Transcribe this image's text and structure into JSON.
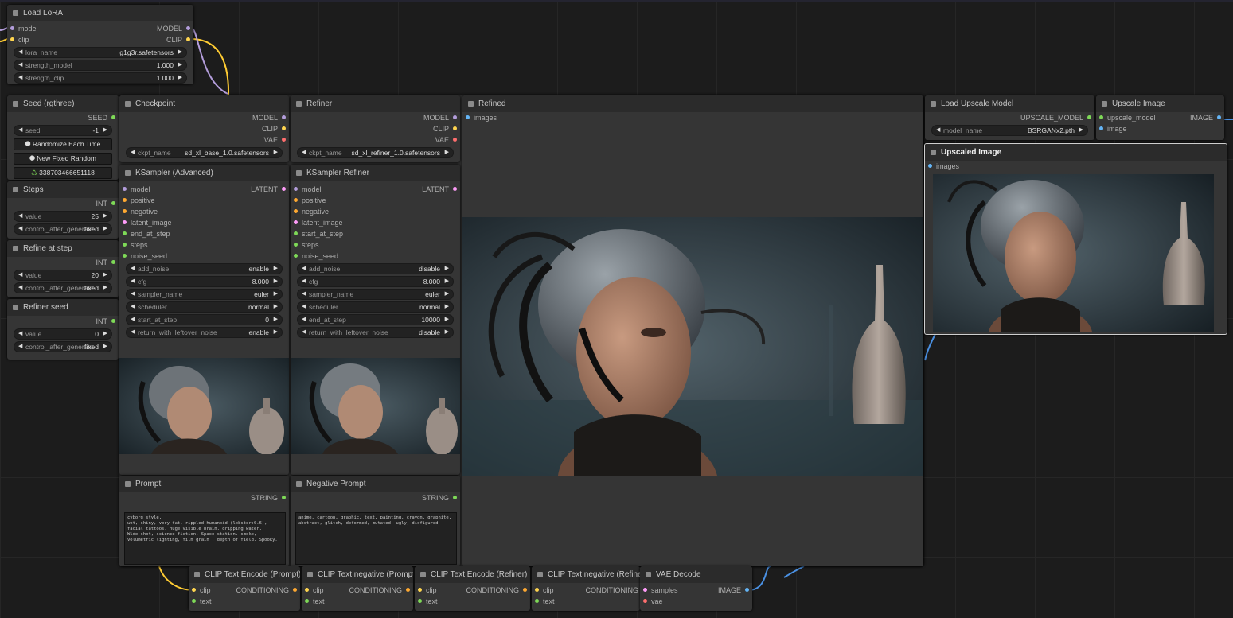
{
  "colors": {
    "model": "#b39ddb",
    "clip": "#ffd54f",
    "vae": "#ff6e6e",
    "latent": "#ff9cf9",
    "conditioning": "#ffa931",
    "int": "#7ed957",
    "string": "#7ed957",
    "image": "#64b5f6",
    "upscale_model": "#7ed957",
    "link_yellow": "#ffcc33",
    "link_purple": "#b39ddb",
    "link_blue": "#4a90e2"
  },
  "load_lora": {
    "title": "Load LoRA",
    "in_model": "model",
    "in_clip": "clip",
    "out_model": "MODEL",
    "out_clip": "CLIP",
    "widgets": [
      {
        "name": "lora_name",
        "value": "g1g3r.safetensors"
      },
      {
        "name": "strength_model",
        "value": "1.000"
      },
      {
        "name": "strength_clip",
        "value": "1.000"
      }
    ]
  },
  "seed": {
    "title": "Seed (rgthree)",
    "out": "SEED",
    "widget_name": "seed",
    "widget_value": "-1",
    "btn_randomize": "Randomize Each Time",
    "btn_new_fixed": "New Fixed Random",
    "btn_last": "338703466651118"
  },
  "steps": {
    "title": "Steps",
    "out": "INT",
    "value_name": "value",
    "value": "25",
    "control_name": "control_after_generate",
    "control_value": "fixed"
  },
  "refine_at_step": {
    "title": "Refine at step",
    "out": "INT",
    "value_name": "value",
    "value": "20",
    "control_name": "control_after_generate",
    "control_value": "fixed"
  },
  "refiner_seed": {
    "title": "Refiner seed",
    "out": "INT",
    "value_name": "value",
    "value": "0",
    "control_name": "control_after_generate",
    "control_value": "fixed"
  },
  "checkpoint": {
    "title": "Checkpoint",
    "out_model": "MODEL",
    "out_clip": "CLIP",
    "out_vae": "VAE",
    "ckpt_label": "ckpt_name",
    "ckpt_value": "sd_xl_base_1.0.safetensors"
  },
  "refiner": {
    "title": "Refiner",
    "out_model": "MODEL",
    "out_clip": "CLIP",
    "out_vae": "VAE",
    "ckpt_label": "ckpt_name",
    "ckpt_value": "sd_xl_refiner_1.0.safetensors"
  },
  "ksampler_adv": {
    "title": "KSampler (Advanced)",
    "out": "LATENT",
    "inputs": [
      "model",
      "positive",
      "negative",
      "latent_image",
      "end_at_step",
      "steps",
      "noise_seed"
    ],
    "widgets": [
      {
        "name": "add_noise",
        "value": "enable"
      },
      {
        "name": "cfg",
        "value": "8.000"
      },
      {
        "name": "sampler_name",
        "value": "euler"
      },
      {
        "name": "scheduler",
        "value": "normal"
      },
      {
        "name": "start_at_step",
        "value": "0"
      },
      {
        "name": "return_with_leftover_noise",
        "value": "enable"
      }
    ]
  },
  "ksampler_ref": {
    "title": "KSampler Refiner",
    "out": "LATENT",
    "inputs": [
      "model",
      "positive",
      "negative",
      "latent_image",
      "start_at_step",
      "steps",
      "noise_seed"
    ],
    "widgets": [
      {
        "name": "add_noise",
        "value": "disable"
      },
      {
        "name": "cfg",
        "value": "8.000"
      },
      {
        "name": "sampler_name",
        "value": "euler"
      },
      {
        "name": "scheduler",
        "value": "normal"
      },
      {
        "name": "end_at_step",
        "value": "10000"
      },
      {
        "name": "return_with_leftover_noise",
        "value": "disable"
      }
    ]
  },
  "refined": {
    "title": "Refined",
    "in_images": "images"
  },
  "load_upscale": {
    "title": "Load Upscale Model",
    "out": "UPSCALE_MODEL",
    "widget_name": "model_name",
    "widget_value": "BSRGANx2.pth"
  },
  "upscale_image": {
    "title": "Upscale Image",
    "in_model": "upscale_model",
    "in_image": "image",
    "out": "IMAGE"
  },
  "upscaled": {
    "title": "Upscaled Image",
    "in_images": "images"
  },
  "prompt": {
    "title": "Prompt",
    "out": "STRING",
    "text": "cyborg style,\nwet, shiny, very fat, rippled humanoid (lobster:0.6),\nfacial tattoos. huge visible brain. dripping water.\nWide shot, science fiction, Space station. smoke,\nvolumetric lighting, film grain , depth of field. Spooky."
  },
  "neg_prompt": {
    "title": "Negative Prompt",
    "out": "STRING",
    "text": "anime, cartoon, graphic, text, painting, crayon, graphite,\nabstract, glitch, deformed, mutated, ugly, disfigured"
  },
  "clip_nodes": [
    {
      "title": "CLIP Text Encode (Prompt)",
      "in1": "clip",
      "in2": "text",
      "out": "CONDITIONING"
    },
    {
      "title": "CLIP Text negative (Prompt)",
      "in1": "clip",
      "in2": "text",
      "out": "CONDITIONING"
    },
    {
      "title": "CLIP Text Encode (Refiner)",
      "in1": "clip",
      "in2": "text",
      "out": "CONDITIONING"
    },
    {
      "title": "CLIP Text negative (Refiner)",
      "in1": "clip",
      "in2": "text",
      "out": "CONDITIONING"
    }
  ],
  "vae_decode": {
    "title": "VAE Decode",
    "in1": "samples",
    "in2": "vae",
    "out": "IMAGE"
  },
  "icons": {
    "arrow_left": "◀",
    "arrow_right": "▶",
    "dice": "⯃",
    "recycle": "♺"
  }
}
